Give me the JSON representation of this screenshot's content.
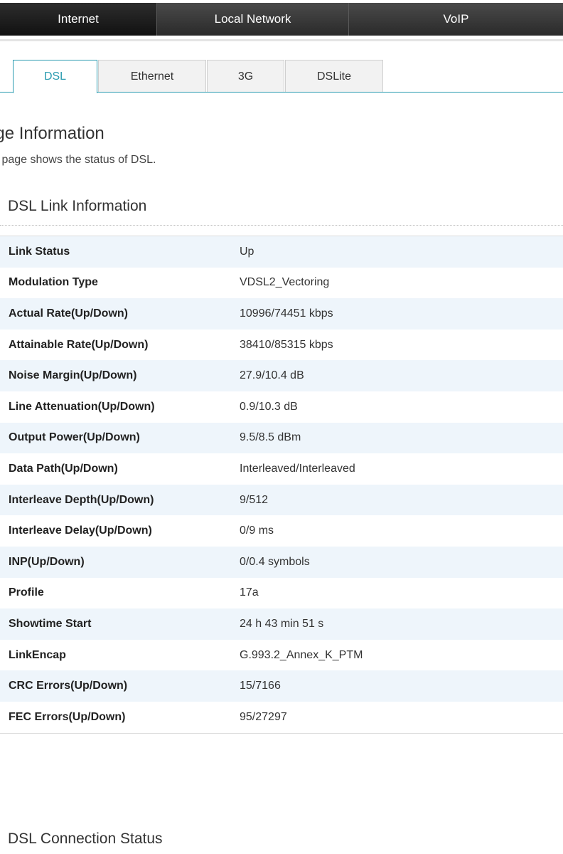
{
  "topnav": {
    "items": [
      {
        "label": "Internet"
      },
      {
        "label": "Local Network"
      },
      {
        "label": "VoIP"
      }
    ]
  },
  "subtabs": {
    "items": [
      {
        "label": "DSL"
      },
      {
        "label": "Ethernet"
      },
      {
        "label": "3G"
      },
      {
        "label": "DSLite"
      }
    ],
    "active": "DSL"
  },
  "page_info": {
    "title": "age Information",
    "description": "s page shows the status of DSL."
  },
  "dsl_link": {
    "title": "DSL Link Information",
    "rows": [
      {
        "label": "Link Status",
        "value": "Up"
      },
      {
        "label": "Modulation Type",
        "value": "VDSL2_Vectoring"
      },
      {
        "label": "Actual Rate(Up/Down)",
        "value": "10996/74451 kbps"
      },
      {
        "label": "Attainable Rate(Up/Down)",
        "value": "38410/85315 kbps"
      },
      {
        "label": "Noise Margin(Up/Down)",
        "value": "27.9/10.4 dB"
      },
      {
        "label": "Line Attenuation(Up/Down)",
        "value": "0.9/10.3 dB"
      },
      {
        "label": "Output Power(Up/Down)",
        "value": "9.5/8.5 dBm"
      },
      {
        "label": "Data Path(Up/Down)",
        "value": "Interleaved/Interleaved"
      },
      {
        "label": "Interleave Depth(Up/Down)",
        "value": "9/512"
      },
      {
        "label": "Interleave Delay(Up/Down)",
        "value": "0/9 ms"
      },
      {
        "label": "INP(Up/Down)",
        "value": "0/0.4 symbols"
      },
      {
        "label": "Profile",
        "value": "17a"
      },
      {
        "label": "Showtime Start",
        "value": "24 h 43 min 51 s"
      },
      {
        "label": "LinkEncap",
        "value": "G.993.2_Annex_K_PTM"
      },
      {
        "label": "CRC Errors(Up/Down)",
        "value": "15/7166"
      },
      {
        "label": "FEC Errors(Up/Down)",
        "value": "95/27297"
      }
    ]
  },
  "dsl_connection": {
    "title": "DSL Connection Status"
  },
  "colors": {
    "accent": "#2a9bb0",
    "row_alt": "#eef5fb",
    "nav_dark": "#111111"
  }
}
